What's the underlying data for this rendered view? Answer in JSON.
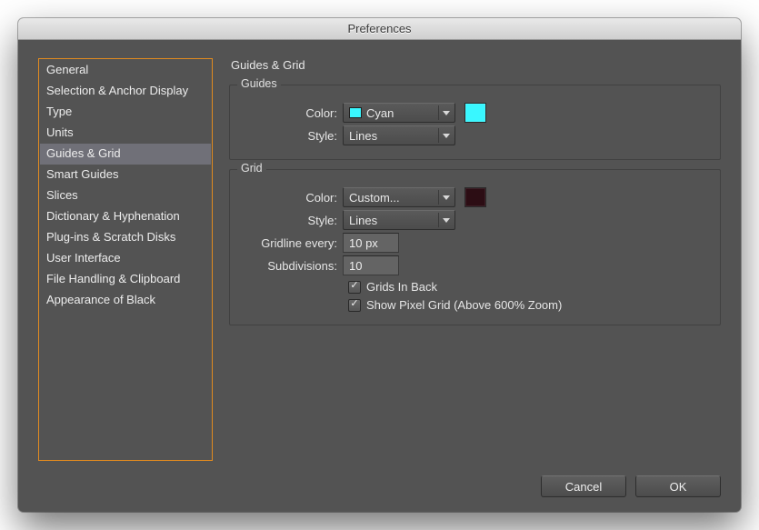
{
  "window": {
    "title": "Preferences"
  },
  "sidebar": {
    "items": [
      {
        "label": "General"
      },
      {
        "label": "Selection & Anchor Display"
      },
      {
        "label": "Type"
      },
      {
        "label": "Units"
      },
      {
        "label": "Guides & Grid",
        "selected": true
      },
      {
        "label": "Smart Guides"
      },
      {
        "label": "Slices"
      },
      {
        "label": "Dictionary & Hyphenation"
      },
      {
        "label": "Plug-ins & Scratch Disks"
      },
      {
        "label": "User Interface"
      },
      {
        "label": "File Handling & Clipboard"
      },
      {
        "label": "Appearance of Black"
      }
    ]
  },
  "pane": {
    "title": "Guides & Grid",
    "guides": {
      "legend": "Guides",
      "color_label": "Color:",
      "color_value": "Cyan",
      "color_swatch": "#39F7FF",
      "style_label": "Style:",
      "style_value": "Lines"
    },
    "grid": {
      "legend": "Grid",
      "color_label": "Color:",
      "color_value": "Custom...",
      "color_swatch": "#2c0d14",
      "style_label": "Style:",
      "style_value": "Lines",
      "gridline_label": "Gridline every:",
      "gridline_value": "10 px",
      "subdivisions_label": "Subdivisions:",
      "subdivisions_value": "10",
      "grids_in_back": {
        "label": "Grids In Back",
        "checked": true
      },
      "show_pixel_grid": {
        "label": "Show Pixel Grid (Above 600% Zoom)",
        "checked": true
      }
    }
  },
  "buttons": {
    "cancel": "Cancel",
    "ok": "OK"
  }
}
